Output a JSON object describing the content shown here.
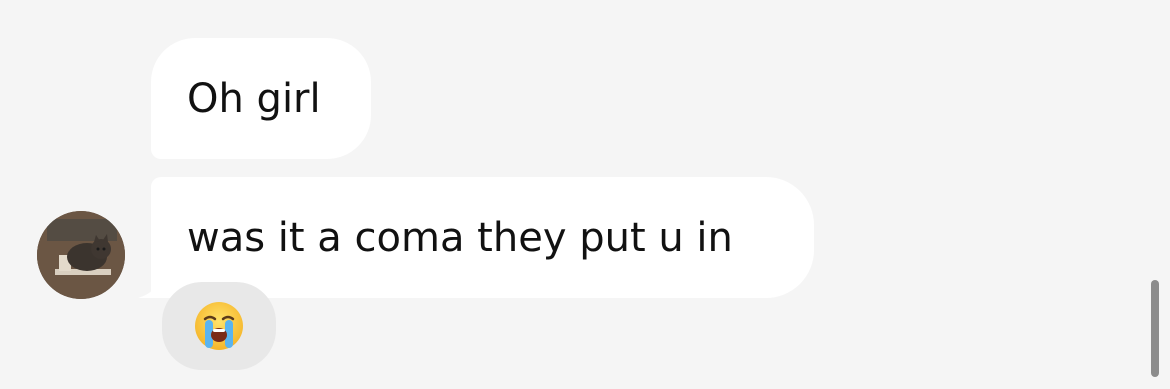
{
  "messages": [
    {
      "text": "Oh girl"
    },
    {
      "text": "was it a coma they put u in"
    }
  ],
  "reaction": {
    "emoji": "loudly-crying-face"
  },
  "colors": {
    "background": "#f5f5f5",
    "bubble": "#ffffff",
    "reaction_pill": "#e8e8e8",
    "text": "#111111",
    "scrollbar": "#8c8c8c"
  }
}
